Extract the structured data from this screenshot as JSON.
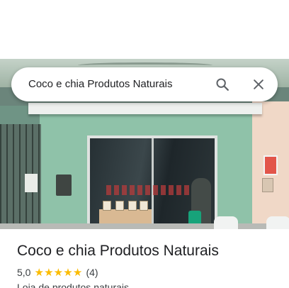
{
  "search": {
    "query": "Coco e chia Produtos Naturais"
  },
  "place": {
    "name": "Coco e chia Produtos Naturais",
    "rating": "5,0",
    "stars": 5,
    "review_count": "(4)",
    "category": "Loja de produtos naturais"
  },
  "colors": {
    "star": "#fbbc04",
    "text_primary": "#202124",
    "text_secondary": "#3c4043"
  },
  "icons": {
    "search": "search-icon",
    "close": "close-icon",
    "star": "star-icon"
  }
}
